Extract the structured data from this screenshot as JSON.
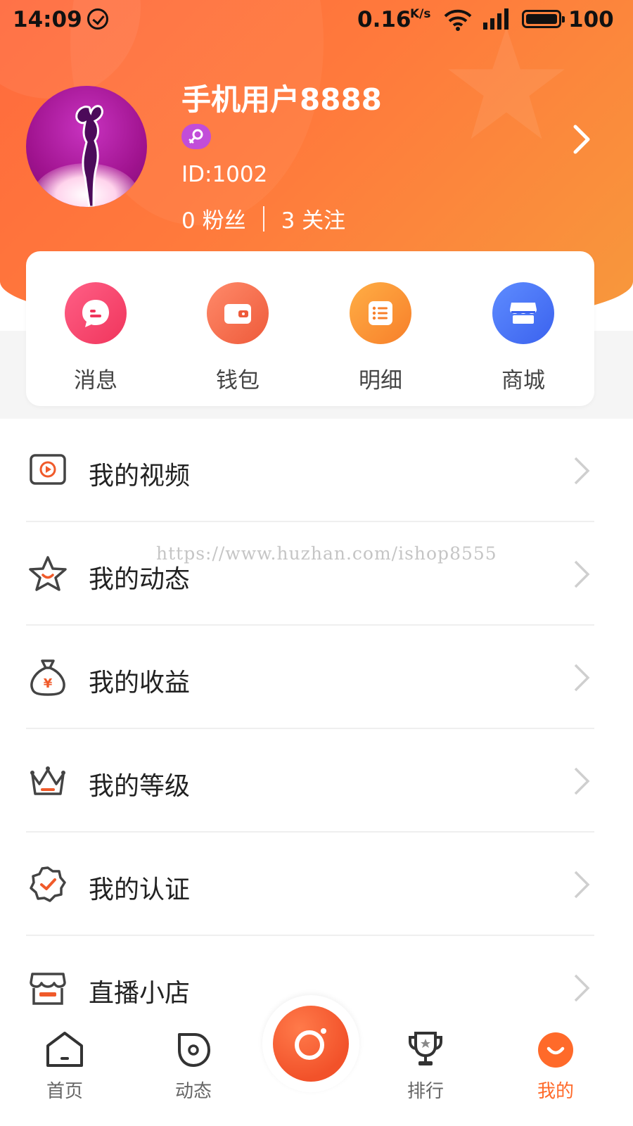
{
  "status_bar": {
    "time": "14:09",
    "speed": "0.16",
    "speed_unit": "K/s",
    "battery": "100"
  },
  "profile": {
    "username": "手机用户8888",
    "user_id": "ID:1002",
    "fans_label": "0 粉丝",
    "following_label": "3 关注",
    "gender": "female"
  },
  "quick_actions": [
    {
      "label": "消息",
      "icon": "message-icon",
      "color": "#f5466f"
    },
    {
      "label": "钱包",
      "icon": "wallet-icon",
      "color": "#f46a4c"
    },
    {
      "label": "明细",
      "icon": "list-icon",
      "color": "#f78a32"
    },
    {
      "label": "商城",
      "icon": "store-icon",
      "color": "#4a74f5"
    }
  ],
  "menu": [
    {
      "label": "我的视频",
      "icon": "video-icon"
    },
    {
      "label": "我的动态",
      "icon": "star-icon"
    },
    {
      "label": "我的收益",
      "icon": "money-bag-icon"
    },
    {
      "label": "我的等级",
      "icon": "crown-icon"
    },
    {
      "label": "我的认证",
      "icon": "verified-badge-icon"
    },
    {
      "label": "直播小店",
      "icon": "shop-icon"
    }
  ],
  "watermark": "https://www.huzhan.com/ishop8555",
  "bottom_nav": [
    {
      "label": "首页",
      "icon": "home-icon"
    },
    {
      "label": "动态",
      "icon": "moments-icon"
    },
    {
      "label": "",
      "icon": "camera-icon"
    },
    {
      "label": "排行",
      "icon": "trophy-icon"
    },
    {
      "label": "我的",
      "icon": "me-icon",
      "active": true
    }
  ],
  "colors": {
    "accent": "#ff6a2a",
    "header_start": "#ff6a3d",
    "header_end": "#f7993c"
  }
}
